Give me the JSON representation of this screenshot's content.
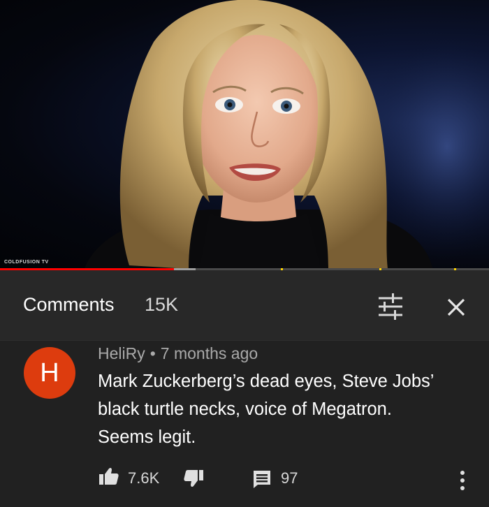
{
  "video": {
    "watermark": "COLDFUSION TV",
    "progress_played": 0.355,
    "progress_buffered": 0.4,
    "colors": {
      "played": "#ff0000",
      "buffer": "#9e9e9e",
      "ad_marker": "#ffd500"
    }
  },
  "comments_panel": {
    "title": "Comments",
    "count": "15K",
    "sort_icon": "sort-filter-icon",
    "close_icon": "close-icon"
  },
  "comment": {
    "avatar_letter": "H",
    "avatar_color": "#dd3c0e",
    "author": "HeliRy",
    "separator": "•",
    "time": "7 months ago",
    "text_lines": [
      "Mark Zuckerberg’s dead eyes, Steve Jobs’",
      "black turtle necks, voice of Megatron.",
      "Seems legit."
    ],
    "likes": "7.6K",
    "replies": "97",
    "like_icon": "thumbs-up-icon",
    "dislike_icon": "thumbs-down-icon",
    "reply_icon": "comment-icon",
    "more_icon": "more-vertical-icon"
  }
}
